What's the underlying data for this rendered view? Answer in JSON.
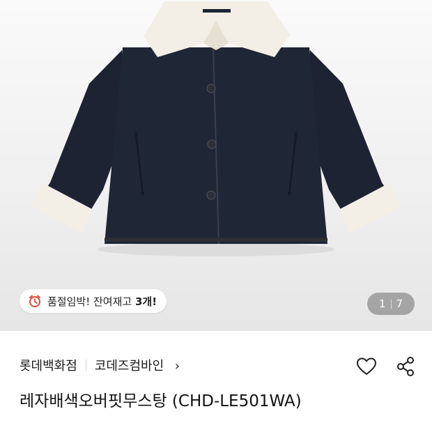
{
  "product_image": {
    "label_icon": "coat-product-photo",
    "colors": {
      "coat": "#1c2231",
      "shearling": "#f3efe6",
      "background": "#efefef"
    }
  },
  "stock_badge": {
    "icon": "alarm-clock-icon",
    "text": "품절임박! 잔여재고 ",
    "count": "3개!"
  },
  "pager": {
    "current": "1",
    "total": "7"
  },
  "brand_row": {
    "store": "롯데백화점",
    "brand": "코데즈컴바인",
    "chevron": "›"
  },
  "actions": {
    "like_icon": "heart-icon",
    "share_icon": "share-icon"
  },
  "product": {
    "title": "레자배색오버핏무스탕 (CHD-LE501WA)"
  }
}
